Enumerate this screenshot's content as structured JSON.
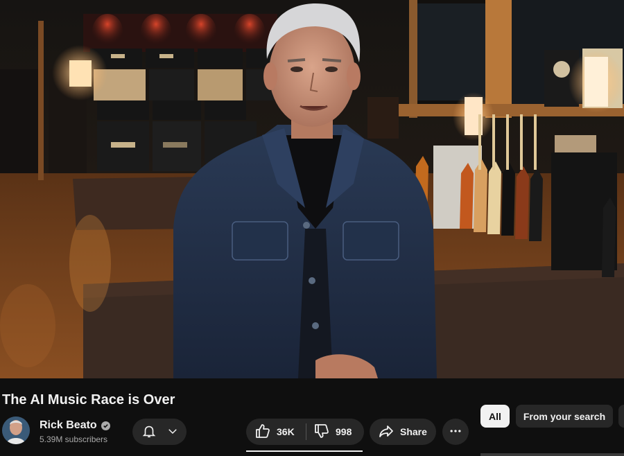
{
  "video": {
    "title": "The AI Music Race is Over"
  },
  "channel": {
    "name": "Rick Beato",
    "subscribers": "5.39M subscribers",
    "verified": true
  },
  "actions": {
    "like_count": "36K",
    "dislike_count": "998",
    "share_label": "Share"
  },
  "chips": {
    "all_label": "All",
    "from_search_label": "From your search"
  },
  "icons": {
    "bell": "bell-icon",
    "chevron": "chevron-down-icon",
    "like": "thumbs-up-icon",
    "dislike": "thumbs-down-icon",
    "share": "share-arrow-icon",
    "more": "more-horizontal-icon",
    "verified": "verified-check-icon"
  },
  "colors": {
    "background": "#0f0f0f",
    "pill": "#272727",
    "text": "#f1f1f1",
    "secondary_text": "#aaaaaa"
  }
}
